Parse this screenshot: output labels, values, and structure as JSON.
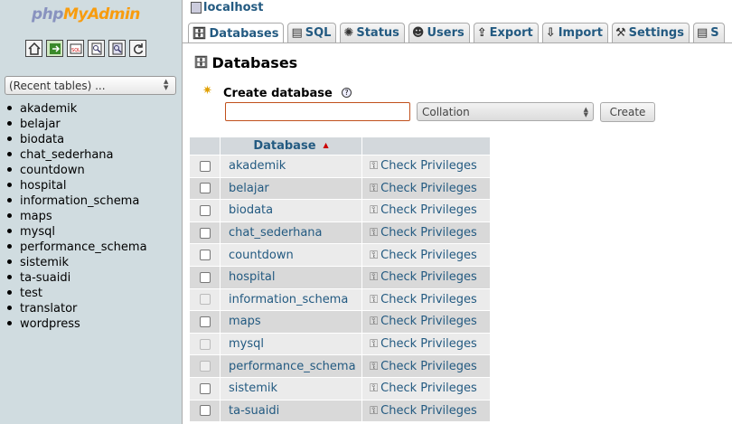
{
  "nav": {
    "logo_php": "php",
    "logo_myadmin": "MyAdmin",
    "icons": [
      "home-icon",
      "exit-icon",
      "sql-query-icon",
      "docs-icon",
      "sql-docs-icon",
      "reload-icon"
    ],
    "recent_tables": "(Recent tables) ...",
    "databases": [
      "akademik",
      "belajar",
      "biodata",
      "chat_sederhana",
      "countdown",
      "hospital",
      "information_schema",
      "maps",
      "mysql",
      "performance_schema",
      "sistemik",
      "ta-suaidi",
      "test",
      "translator",
      "wordpress"
    ]
  },
  "header": {
    "server": "localhost"
  },
  "tabs": [
    {
      "label": "Databases",
      "icon": "databases-icon",
      "active": true
    },
    {
      "label": "SQL",
      "icon": "sql-icon"
    },
    {
      "label": "Status",
      "icon": "status-icon"
    },
    {
      "label": "Users",
      "icon": "users-icon"
    },
    {
      "label": "Export",
      "icon": "export-icon"
    },
    {
      "label": "Import",
      "icon": "import-icon"
    },
    {
      "label": "Settings",
      "icon": "settings-icon"
    },
    {
      "label": "S",
      "icon": "more-icon"
    }
  ],
  "page": {
    "title": "Databases",
    "create_label": "Create database",
    "help_glyph": "?",
    "dbname_value": "",
    "collation": "Collation",
    "create_button": "Create"
  },
  "table": {
    "header_database": "Database",
    "privileges_label": "Check Privileges",
    "rows": [
      {
        "name": "akademik",
        "system": false
      },
      {
        "name": "belajar",
        "system": false
      },
      {
        "name": "biodata",
        "system": false
      },
      {
        "name": "chat_sederhana",
        "system": false
      },
      {
        "name": "countdown",
        "system": false
      },
      {
        "name": "hospital",
        "system": false
      },
      {
        "name": "information_schema",
        "system": true
      },
      {
        "name": "maps",
        "system": false
      },
      {
        "name": "mysql",
        "system": true
      },
      {
        "name": "performance_schema",
        "system": true
      },
      {
        "name": "sistemik",
        "system": false
      },
      {
        "name": "ta-suaidi",
        "system": false
      }
    ]
  },
  "colors": {
    "link": "#235a81",
    "nav_bg": "#d0dce0",
    "row_odd": "#ebebeb",
    "row_even": "#d9d9d9",
    "input_border": "#c0501c"
  }
}
